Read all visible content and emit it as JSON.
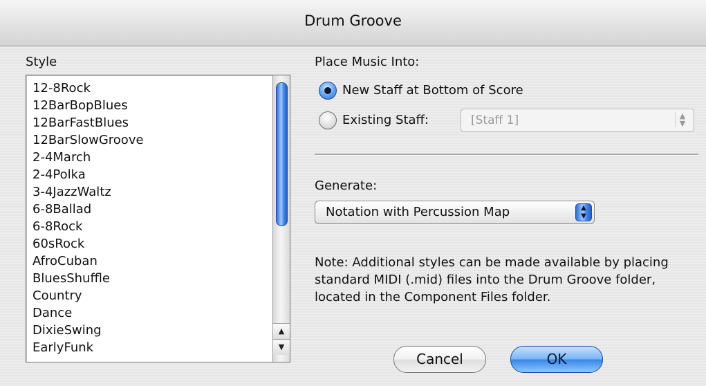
{
  "window": {
    "title": "Drum Groove"
  },
  "style": {
    "label": "Style",
    "items": [
      "12-8Rock",
      "12BarBopBlues",
      "12BarFastBlues",
      "12BarSlowGroove",
      "2-4March",
      "2-4Polka",
      "3-4JazzWaltz",
      "6-8Ballad",
      "6-8Rock",
      "60sRock",
      "AfroCuban",
      "BluesShuffle",
      "Country",
      "Dance",
      "DixieSwing",
      "EarlyFunk"
    ]
  },
  "place": {
    "label": "Place Music Into:",
    "new_staff_label": "New Staff at Bottom of Score",
    "existing_staff_label": "Existing Staff:",
    "existing_staff_value": "[Staff 1]",
    "selected": "new_staff"
  },
  "generate": {
    "label": "Generate:",
    "value": "Notation with Percussion Map"
  },
  "note": "Note: Additional styles can be made available by placing standard MIDI (.mid) files into the Drum Groove folder, located in the Component Files folder.",
  "buttons": {
    "cancel": "Cancel",
    "ok": "OK"
  },
  "colors": {
    "accent": "#3a86e6"
  }
}
